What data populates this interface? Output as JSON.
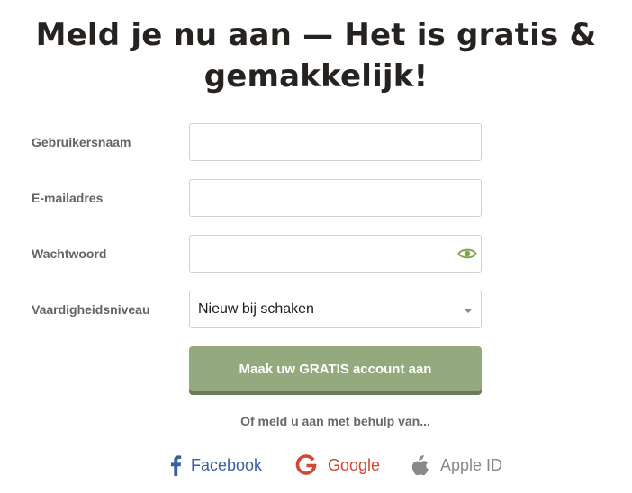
{
  "heading": "Meld je nu aan — Het is gratis & gemakkelijk!",
  "form": {
    "username": {
      "label": "Gebruikersnaam",
      "value": ""
    },
    "email": {
      "label": "E-mailadres",
      "value": ""
    },
    "password": {
      "label": "Wachtwoord",
      "value": "",
      "toggle_icon": "eye-icon"
    },
    "skill": {
      "label": "Vaardigheidsniveau",
      "selected": "Nieuw bij schaken"
    },
    "submit_label": "Maak uw GRATIS account aan"
  },
  "social": {
    "intro": "Of meld u aan met behulp van...",
    "providers": [
      {
        "label": "Facebook",
        "icon": "facebook-icon",
        "color": "#3b5f9e"
      },
      {
        "label": "Google",
        "icon": "google-icon",
        "color": "#d34635"
      },
      {
        "label": "Apple ID",
        "icon": "apple-icon",
        "color": "#8b8987"
      }
    ]
  },
  "colors": {
    "button": "#95a97e",
    "button_shadow": "#6c7b5b",
    "eye_icon": "#7fa650"
  }
}
